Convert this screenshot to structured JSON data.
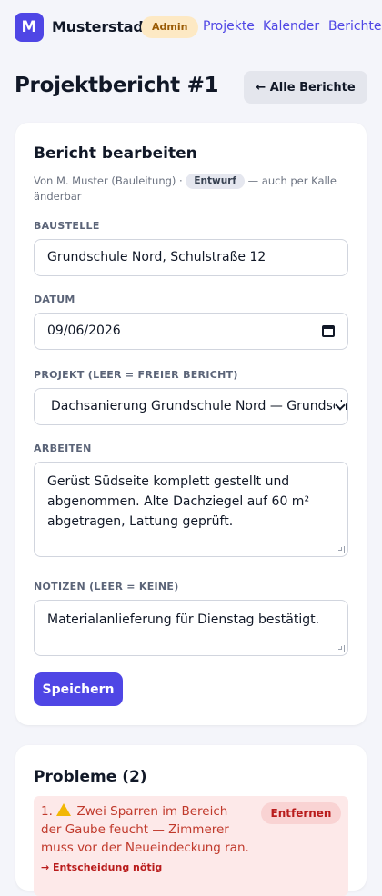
{
  "header": {
    "logo_letter": "M",
    "brand": "Musterstadt",
    "role_badge": "Admin",
    "nav": [
      "Projekte",
      "Kalender",
      "Berichte"
    ]
  },
  "page": {
    "title": "Projektbericht #1",
    "back_label": "← Alle Berichte"
  },
  "form": {
    "title": "Bericht bearbeiten",
    "byline_prefix": "Von M. Muster (Bauleitung) ·",
    "status": "Entwurf",
    "byline_suffix": "— auch per Kalle änderbar",
    "fields": {
      "baustelle_label": "BAUSTELLE",
      "baustelle_value": "Grundschule Nord, Schulstraße 12",
      "datum_label": "DATUM",
      "datum_value": "09/06/2026",
      "projekt_label": "PROJEKT (LEER = FREIER BERICHT)",
      "projekt_value": "Dachsanierung Grundschule Nord — Grundschule Nord",
      "arbeiten_label": "ARBEITEN",
      "arbeiten_value": "Gerüst Südseite komplett gestellt und abgenommen. Alte Dachziegel auf 60 m² abgetragen, Lattung geprüft.",
      "notizen_label": "NOTIZEN (LEER = KEINE)",
      "notizen_value": "Materialanlieferung für Dienstag bestätigt."
    },
    "save_label": "Speichern"
  },
  "problems": {
    "title": "Probleme (2)",
    "items": [
      {
        "number": "1.",
        "text": "Zwei Sparren im Bereich der Gaube feucht — Zimmerer muss vor der Neueindeckung ran.",
        "decision": "→ Entscheidung nötig",
        "remove_label": "Entfernen"
      }
    ]
  },
  "colors": {
    "accent": "#4f46e5",
    "admin_badge_bg": "#fde9c4",
    "problem_bg": "#fde9e9",
    "problem_text": "#c0392b"
  }
}
